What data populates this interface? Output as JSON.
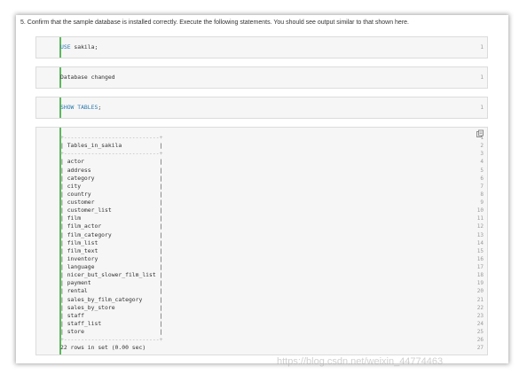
{
  "instruction": "5. Confirm that the sample database is installed correctly. Execute the following statements. You should see output similar to that shown here.",
  "blocks": {
    "use": {
      "line": "1",
      "keyword": "USE",
      "rest": " sakila;"
    },
    "changed": {
      "line": "1",
      "text": "Database changed"
    },
    "show": {
      "line": "1",
      "keyword": "SHOW TABLES",
      "rest": ";"
    }
  },
  "output": {
    "line_numbers": [
      "1",
      "2",
      "3",
      "4",
      "5",
      "6",
      "7",
      "8",
      "9",
      "10",
      "11",
      "12",
      "13",
      "14",
      "15",
      "16",
      "17",
      "18",
      "19",
      "20",
      "21",
      "22",
      "23",
      "24",
      "25",
      "26",
      "27"
    ],
    "lines": [
      "+----------------------------+",
      "| Tables_in_sakila           |",
      "+----------------------------+",
      "| actor                      |",
      "| address                    |",
      "| category                   |",
      "| city                       |",
      "| country                    |",
      "| customer                   |",
      "| customer_list              |",
      "| film                       |",
      "| film_actor                 |",
      "| film_category              |",
      "| film_list                  |",
      "| film_text                  |",
      "| inventory                  |",
      "| language                   |",
      "| nicer_but_slower_film_list |",
      "| payment                    |",
      "| rental                     |",
      "| sales_by_film_category     |",
      "| sales_by_store             |",
      "| staff                      |",
      "| staff_list                 |",
      "| store                      |",
      "+----------------------------+",
      "22 rows in set (0.00 sec)"
    ],
    "copy_icon": "copy-icon"
  },
  "watermark": "https://blog.csdn.net/weixin_44774463",
  "colors": {
    "accent_gutter": "#5cb85c",
    "keyword": "#2a7ab0",
    "block_bg": "#f6f6f6"
  }
}
